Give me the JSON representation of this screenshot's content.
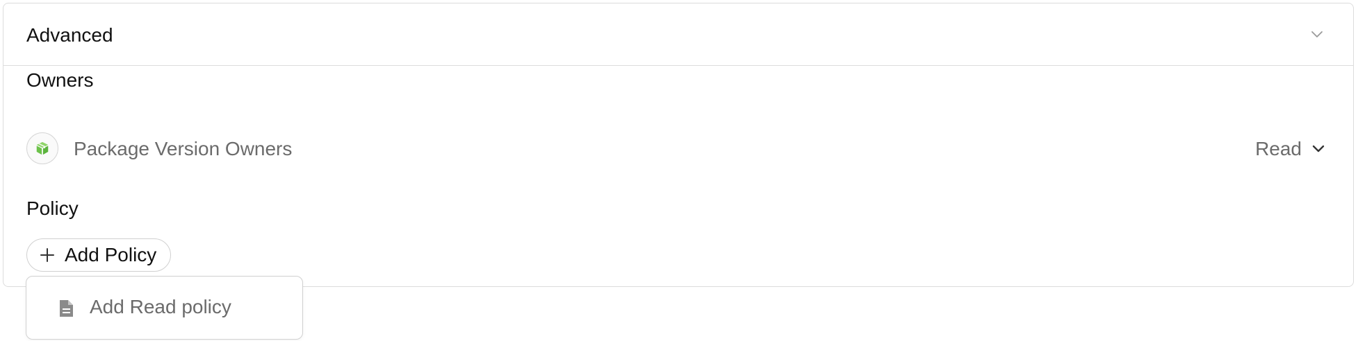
{
  "panel": {
    "title": "Advanced"
  },
  "owners": {
    "label": "Owners",
    "items": [
      {
        "name": "Package Version Owners",
        "role": "Read",
        "icon": "package-icon"
      }
    ]
  },
  "policy": {
    "label": "Policy",
    "add_button_label": "Add Policy",
    "dropdown_items": [
      {
        "label": "Add Read policy",
        "icon": "document-icon"
      }
    ]
  },
  "colors": {
    "border": "#dcdcdc",
    "text_primary": "#111111",
    "text_secondary": "#6b6b6b",
    "package_icon_green": "#6cc24a"
  }
}
